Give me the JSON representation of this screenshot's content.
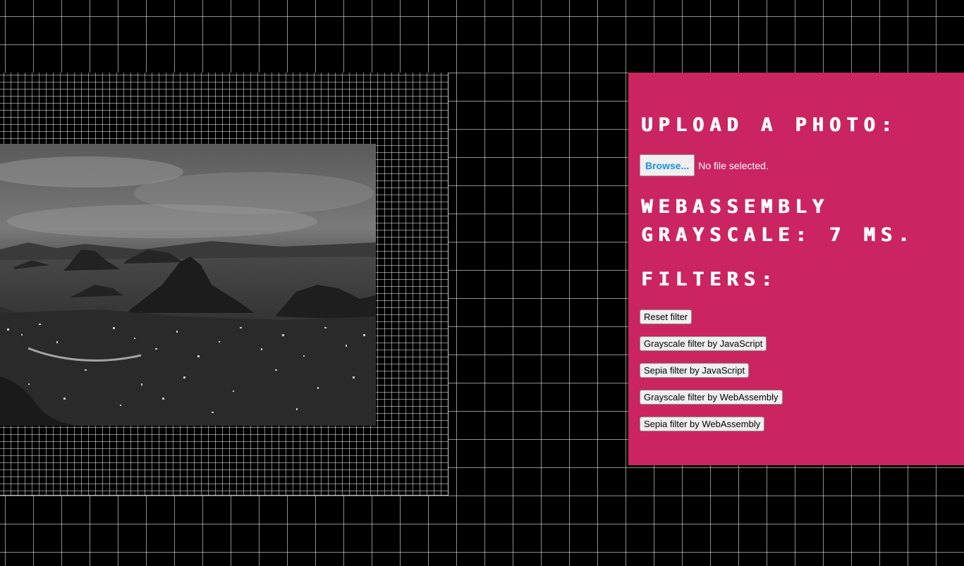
{
  "upload": {
    "heading": "Upload a photo:",
    "browse_label": "Browse...",
    "file_status": "No file selected."
  },
  "timing": {
    "text": "WebAssembly Grayscale: 7 ms."
  },
  "filters": {
    "heading": "Filters:",
    "reset_label": "Reset filter",
    "grayscale_js_label": "Grayscale filter by JavaScript",
    "sepia_js_label": "Sepia filter by JavaScript",
    "grayscale_wasm_label": "Grayscale filter by WebAssembly",
    "sepia_wasm_label": "Sepia filter by WebAssembly"
  },
  "colors": {
    "panel_background": "#cb2561",
    "page_background": "#000000",
    "grid_line": "#8c8c8c",
    "browse_text": "#1a8fe3"
  }
}
